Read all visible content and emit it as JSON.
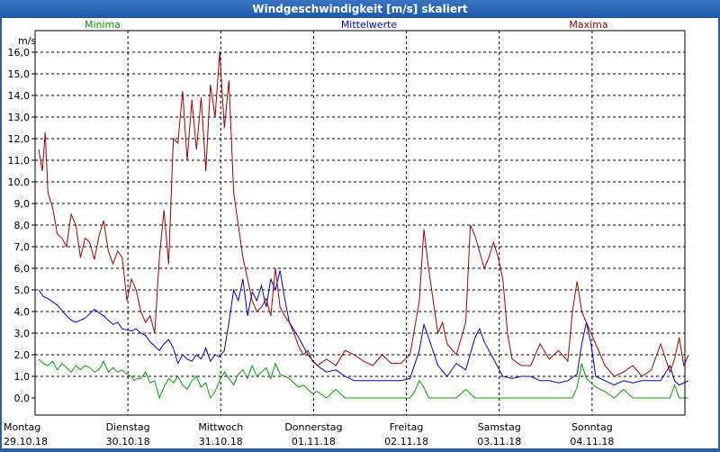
{
  "window": {
    "title": "Windgeschwindigkeit [m/s] skaliert"
  },
  "chart_data": {
    "type": "line",
    "ylabel": "m/s",
    "ylim": [
      0,
      16.5
    ],
    "yticks": [
      "0,0",
      "1,0",
      "2,0",
      "3,0",
      "4,0",
      "5,0",
      "6,0",
      "7,0",
      "8,0",
      "9,0",
      "10,0",
      "11,0",
      "12,0",
      "13,0",
      "14,0",
      "15,0",
      "16,0"
    ],
    "xlim": [
      0,
      7
    ],
    "days": [
      {
        "name": "Montag",
        "date": "29.10.18"
      },
      {
        "name": "Dienstag",
        "date": "30.10.18"
      },
      {
        "name": "Mittwoch",
        "date": "31.10.18"
      },
      {
        "name": "Donnerstag",
        "date": "01.11.18"
      },
      {
        "name": "Freitag",
        "date": "02.11.18"
      },
      {
        "name": "Samstag",
        "date": "03.11.18"
      },
      {
        "name": "Sonntag",
        "date": "04.11.18"
      }
    ],
    "grid": true,
    "series": [
      {
        "name": "Minima",
        "color": "#00a000",
        "legend_pos": "left",
        "x": [
          0,
          0.05,
          0.1,
          0.15,
          0.2,
          0.25,
          0.3,
          0.35,
          0.4,
          0.45,
          0.5,
          0.55,
          0.6,
          0.65,
          0.7,
          0.75,
          0.8,
          0.85,
          0.9,
          0.95,
          1.0,
          1.03,
          1.06,
          1.1,
          1.15,
          1.2,
          1.25,
          1.3,
          1.35,
          1.4,
          1.45,
          1.5,
          1.55,
          1.6,
          1.65,
          1.7,
          1.75,
          1.8,
          1.85,
          1.9,
          1.95,
          2.0,
          2.05,
          2.1,
          2.15,
          2.2,
          2.25,
          2.3,
          2.35,
          2.4,
          2.45,
          2.5,
          2.55,
          2.6,
          2.65,
          2.7,
          2.75,
          2.8,
          2.85,
          2.9,
          2.95,
          3.0,
          3.1,
          3.2,
          3.3,
          3.4,
          3.5,
          3.6,
          3.7,
          3.8,
          3.9,
          4.0,
          4.05,
          4.1,
          4.15,
          4.2,
          4.3,
          4.4,
          4.5,
          4.6,
          4.7,
          4.8,
          4.9,
          5.0,
          5.1,
          5.2,
          5.3,
          5.4,
          5.5,
          5.6,
          5.7,
          5.75,
          5.8,
          5.85,
          5.9,
          6.0,
          6.1,
          6.2,
          6.3,
          6.4,
          6.5,
          6.6,
          6.7,
          6.8,
          6.85,
          6.9,
          6.95,
          7.0
        ],
        "y": [
          1.8,
          1.6,
          1.5,
          1.7,
          1.3,
          1.6,
          1.4,
          1.2,
          1.5,
          1.3,
          1.5,
          1.4,
          1.2,
          1.3,
          1.7,
          1.2,
          1.4,
          1.2,
          1.3,
          1.1,
          1.0,
          0.8,
          0.9,
          0.9,
          1.2,
          0.7,
          0.8,
          0.0,
          0.5,
          0.9,
          0.7,
          1.0,
          0.6,
          0.4,
          0.8,
          1.0,
          0.5,
          0.7,
          0.0,
          0.3,
          0.8,
          1.2,
          0.9,
          0.6,
          1.1,
          1.3,
          0.9,
          1.5,
          1.0,
          1.2,
          1.4,
          0.9,
          1.6,
          1.1,
          1.0,
          0.9,
          0.7,
          0.5,
          0.6,
          0.4,
          0.2,
          0.3,
          0.0,
          0.4,
          0.0,
          0.0,
          0.0,
          0.0,
          0.0,
          0.0,
          0.0,
          0.0,
          0.3,
          0.8,
          0.5,
          0.0,
          0.0,
          0.0,
          0.0,
          0.4,
          0.0,
          0.0,
          0.0,
          0.0,
          0.0,
          0.0,
          0.0,
          0.0,
          0.0,
          0.0,
          0.0,
          0.0,
          0.5,
          1.6,
          0.9,
          0.5,
          0.3,
          0.0,
          0.4,
          0.0,
          0.0,
          0.0,
          0.0,
          0.0,
          0.6,
          0.0,
          0.0,
          0.0
        ]
      },
      {
        "name": "Mittelwerte",
        "color": "#0000c8",
        "legend_pos": "center",
        "x": [
          0,
          0.05,
          0.1,
          0.2,
          0.3,
          0.35,
          0.4,
          0.5,
          0.6,
          0.7,
          0.8,
          0.85,
          0.9,
          1.0,
          1.05,
          1.1,
          1.15,
          1.2,
          1.3,
          1.35,
          1.4,
          1.45,
          1.5,
          1.55,
          1.6,
          1.65,
          1.7,
          1.75,
          1.8,
          1.85,
          1.9,
          1.95,
          2.0,
          2.05,
          2.1,
          2.15,
          2.2,
          2.25,
          2.3,
          2.35,
          2.4,
          2.45,
          2.5,
          2.55,
          2.6,
          2.65,
          2.7,
          2.8,
          2.9,
          3.0,
          3.1,
          3.2,
          3.3,
          3.4,
          3.5,
          3.6,
          3.7,
          3.8,
          3.9,
          4.0,
          4.1,
          4.15,
          4.2,
          4.3,
          4.4,
          4.5,
          4.6,
          4.7,
          4.75,
          4.8,
          4.85,
          4.9,
          5.0,
          5.1,
          5.2,
          5.3,
          5.4,
          5.5,
          5.6,
          5.7,
          5.8,
          5.85,
          5.9,
          5.95,
          6.0,
          6.1,
          6.2,
          6.3,
          6.4,
          6.5,
          6.6,
          6.7,
          6.8,
          6.85,
          6.9,
          7.0
        ],
        "y": [
          5.0,
          4.7,
          4.6,
          4.3,
          3.8,
          3.6,
          3.5,
          3.7,
          4.1,
          3.8,
          3.4,
          3.5,
          3.2,
          3.1,
          3.2,
          3.0,
          2.9,
          2.6,
          2.2,
          2.5,
          2.7,
          2.3,
          1.6,
          2.0,
          1.8,
          1.7,
          2.0,
          1.8,
          2.3,
          1.7,
          2.0,
          1.9,
          2.2,
          3.5,
          5.0,
          4.5,
          5.5,
          3.8,
          4.9,
          4.5,
          5.2,
          4.2,
          5.5,
          5.0,
          5.9,
          4.6,
          3.5,
          2.8,
          2.0,
          1.5,
          1.2,
          1.3,
          1.0,
          0.8,
          0.8,
          0.8,
          0.8,
          0.8,
          0.8,
          0.9,
          2.2,
          3.4,
          2.8,
          1.5,
          1.0,
          1.6,
          1.3,
          2.8,
          3.2,
          2.6,
          2.2,
          1.8,
          1.0,
          0.9,
          1.0,
          1.0,
          0.8,
          0.8,
          0.7,
          0.8,
          1.1,
          2.5,
          3.5,
          2.5,
          1.0,
          0.8,
          0.6,
          0.8,
          0.7,
          0.8,
          0.8,
          0.8,
          1.5,
          0.8,
          0.6,
          0.8
        ]
      },
      {
        "name": "Maxima",
        "color": "#a00000",
        "legend_pos": "right",
        "x": [
          0,
          0.04,
          0.07,
          0.1,
          0.15,
          0.2,
          0.25,
          0.3,
          0.35,
          0.4,
          0.45,
          0.5,
          0.55,
          0.6,
          0.65,
          0.7,
          0.75,
          0.8,
          0.85,
          0.9,
          0.95,
          1.0,
          1.05,
          1.1,
          1.15,
          1.2,
          1.25,
          1.3,
          1.35,
          1.4,
          1.45,
          1.5,
          1.55,
          1.6,
          1.65,
          1.7,
          1.75,
          1.8,
          1.85,
          1.9,
          1.95,
          2.0,
          2.05,
          2.1,
          2.15,
          2.2,
          2.25,
          2.3,
          2.35,
          2.4,
          2.45,
          2.5,
          2.55,
          2.6,
          2.65,
          2.7,
          2.75,
          2.8,
          2.85,
          2.9,
          2.95,
          3.0,
          3.1,
          3.2,
          3.3,
          3.4,
          3.5,
          3.6,
          3.7,
          3.8,
          3.9,
          4.0,
          4.1,
          4.15,
          4.2,
          4.3,
          4.35,
          4.4,
          4.5,
          4.6,
          4.65,
          4.7,
          4.8,
          4.85,
          4.9,
          4.95,
          5.0,
          5.05,
          5.1,
          5.2,
          5.3,
          5.4,
          5.5,
          5.6,
          5.7,
          5.75,
          5.8,
          5.85,
          5.9,
          6.0,
          6.1,
          6.2,
          6.3,
          6.4,
          6.5,
          6.6,
          6.7,
          6.8,
          6.85,
          6.9,
          6.95,
          7.0
        ],
        "y": [
          11.5,
          10.5,
          12.3,
          9.5,
          8.8,
          7.6,
          7.4,
          7.0,
          8.5,
          8.0,
          6.5,
          7.4,
          7.2,
          6.4,
          7.5,
          8.2,
          6.8,
          6.2,
          6.8,
          6.5,
          4.5,
          5.5,
          5.0,
          4.0,
          3.5,
          3.8,
          3.0,
          6.5,
          8.7,
          6.2,
          12.0,
          11.8,
          14.2,
          11.0,
          13.8,
          11.5,
          13.9,
          10.5,
          14.5,
          13.0,
          16.0,
          12.5,
          14.7,
          9.5,
          8.0,
          6.5,
          5.5,
          4.5,
          4.0,
          4.2,
          4.6,
          3.8,
          6.0,
          4.2,
          3.8,
          3.5,
          3.0,
          2.4,
          2.0,
          2.2,
          1.7,
          1.5,
          1.8,
          1.5,
          2.2,
          2.0,
          1.7,
          1.5,
          2.0,
          1.6,
          1.6,
          2.0,
          4.5,
          7.8,
          6.0,
          3.0,
          3.5,
          2.5,
          2.0,
          3.5,
          8.0,
          7.5,
          6.0,
          6.5,
          7.2,
          6.5,
          5.5,
          3.0,
          1.8,
          1.5,
          1.5,
          2.5,
          1.8,
          2.2,
          1.7,
          4.0,
          5.4,
          4.0,
          3.5,
          2.5,
          1.5,
          1.0,
          1.2,
          1.5,
          1.0,
          1.3,
          2.5,
          1.2,
          1.8,
          2.8,
          1.5,
          2.0
        ]
      }
    ]
  }
}
